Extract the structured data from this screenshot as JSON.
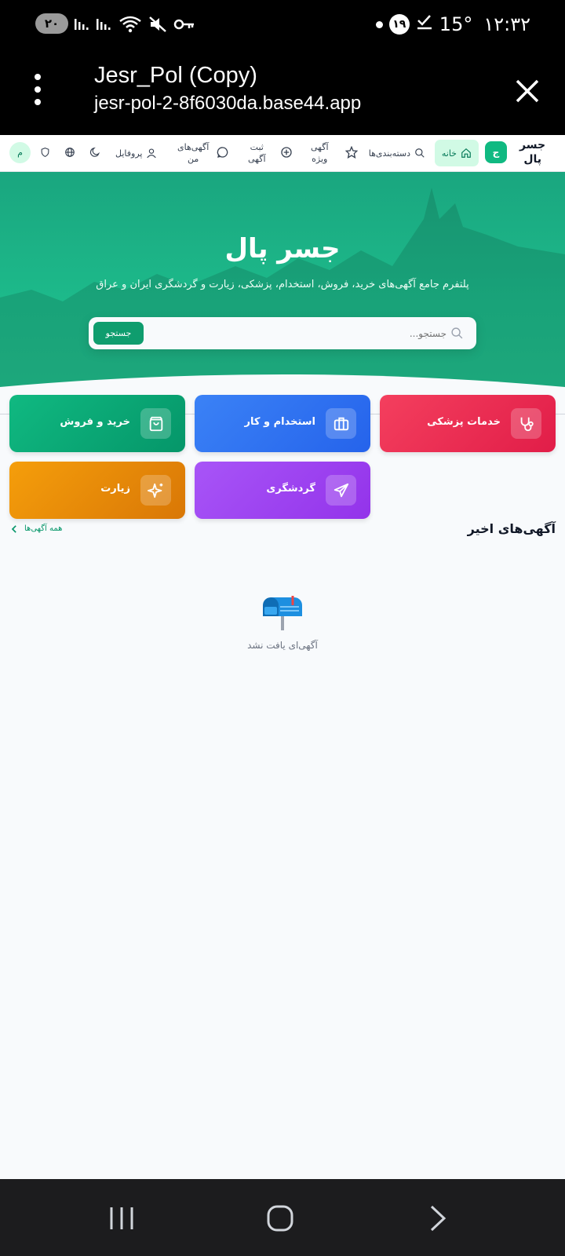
{
  "status_bar": {
    "pill": "۲۰",
    "clock": "۱۲:۳۲",
    "temp": "15°",
    "badge": "۱۹"
  },
  "browser": {
    "title": "Jesr_Pol (Copy)",
    "url": "jesr-pol-2-8f6030da.base44.app"
  },
  "nav": {
    "brand": "جسر پال",
    "logo": "ج",
    "home": "خانه",
    "categories": "دسته‌بندی‌ها",
    "featured_line1": "آگهی",
    "featured_line2": "ویژه",
    "post_line1": "ثبت",
    "post_line2": "آگهی",
    "my_ads_line1": "آگهی‌های",
    "my_ads_line2": "من",
    "profile": "پروفایل",
    "avatar": "م"
  },
  "hero": {
    "title": "جسر پال",
    "subtitle": "پلتفرم جامع آگهی‌های خرید، فروش، استخدام، پزشکی، زیارت و گردشگری ایران و عراق",
    "search_placeholder": "جستجو...",
    "search_button": "جستجو"
  },
  "categories": [
    {
      "label": "خدمات پزشکی",
      "icon": "stethoscope-icon",
      "color": "#e11d48"
    },
    {
      "label": "استخدام و کار",
      "icon": "briefcase-icon",
      "color": "#2563eb"
    },
    {
      "label": "خرید و فروش",
      "icon": "shopping-bag-icon",
      "color": "#059669"
    },
    {
      "label": "گردشگری",
      "icon": "plane-icon",
      "color": "#9333ea"
    },
    {
      "label": "زیارت",
      "icon": "sparkles-icon",
      "color": "#d97706"
    }
  ],
  "recent": {
    "title": "آگهی‌های اخیر",
    "all_link": "همه آگهی‌ها",
    "empty_text": "آگهی‌ای یافت نشد"
  }
}
